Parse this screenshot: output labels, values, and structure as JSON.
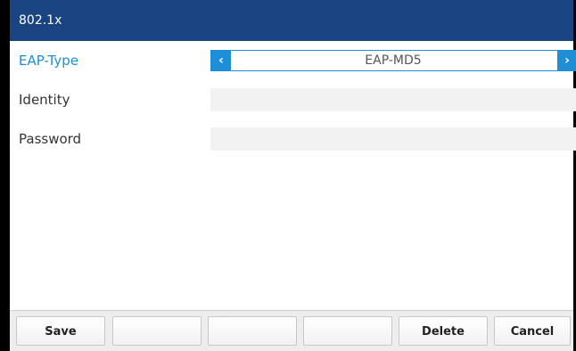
{
  "title": "802.1x",
  "rows": [
    {
      "label": "EAP-Type",
      "value": "EAP-MD5"
    },
    {
      "label": "Identity",
      "value": ""
    },
    {
      "label": "Password",
      "value": ""
    }
  ],
  "icons": {
    "prev": "‹",
    "next": "›"
  },
  "softkeys": [
    "Save",
    "",
    "",
    "",
    "Delete",
    "Cancel"
  ],
  "colors": {
    "title_bar": "#1b4582",
    "accent": "#1e8fd6"
  }
}
